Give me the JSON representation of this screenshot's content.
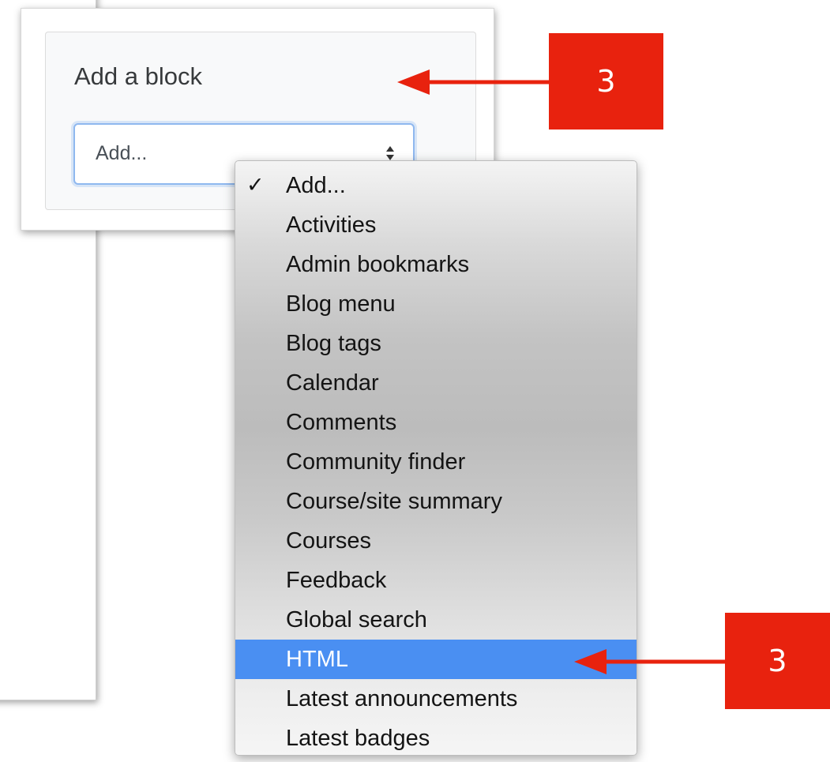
{
  "block": {
    "title": "Add a block",
    "select_value": "Add..."
  },
  "dropdown": {
    "checked_index": 0,
    "highlighted_index": 12,
    "items": [
      {
        "label": "Add..."
      },
      {
        "label": "Activities"
      },
      {
        "label": "Admin bookmarks"
      },
      {
        "label": "Blog menu"
      },
      {
        "label": "Blog tags"
      },
      {
        "label": "Calendar"
      },
      {
        "label": "Comments"
      },
      {
        "label": "Community finder"
      },
      {
        "label": "Course/site summary"
      },
      {
        "label": "Courses"
      },
      {
        "label": "Feedback"
      },
      {
        "label": "Global search"
      },
      {
        "label": "HTML"
      },
      {
        "label": "Latest announcements"
      },
      {
        "label": "Latest badges"
      }
    ]
  },
  "annotations": {
    "top_step": "3",
    "bottom_step": "3",
    "color": "#e8220e"
  },
  "colors": {
    "highlight": "#4a8ff2",
    "focus_border": "#8fb8ef"
  },
  "icons": {
    "checkmark": "checkmark-icon",
    "select_arrows": "select-arrows-icon"
  }
}
